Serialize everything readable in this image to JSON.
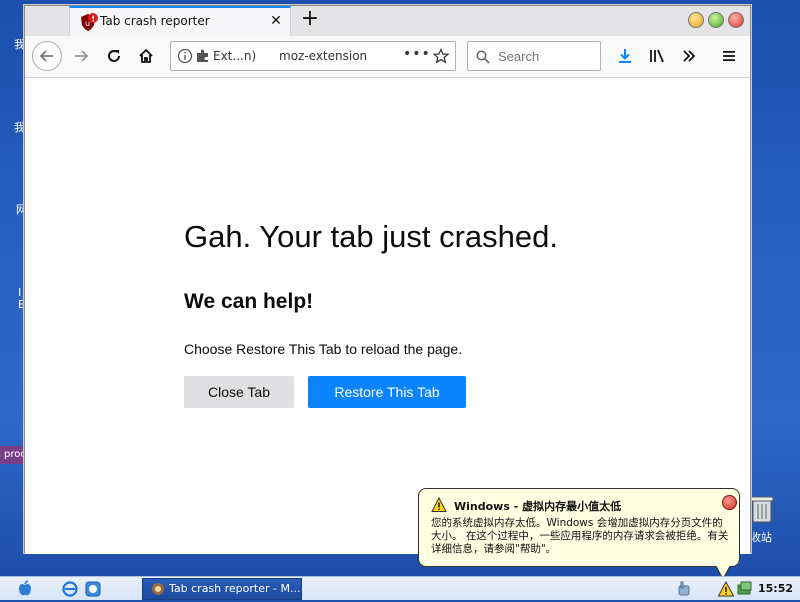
{
  "desktop": {
    "labels": [
      "我",
      "我",
      "网",
      "I",
      "E"
    ],
    "pill_label": "proc",
    "recycle_label": "收站"
  },
  "browser": {
    "tab_title": "Tab crash reporter",
    "new_tab_label": "+",
    "tab_close_label": "✕",
    "urlbar": {
      "identity_label": "Ext...n)",
      "url_text": "moz-extension",
      "page_actions_label": "•••"
    },
    "search": {
      "placeholder": "Search"
    }
  },
  "page": {
    "title": "Gah. Your tab just crashed.",
    "help_heading": "We can help!",
    "help_text": "Choose Restore This Tab to reload the page.",
    "close_tab_label": "Close Tab",
    "restore_tab_label": "Restore This Tab"
  },
  "taskbar": {
    "task_label": "Tab crash reporter - M...",
    "clock": "15:52"
  },
  "balloon": {
    "title": "Windows - 虚拟内存最小值太低",
    "text": "您的系统虚拟内存太低。Windows 会增加虚拟内存分页文件的大小。 在这个过程中，一些应用程序的内存请求会被拒绝。有关详细信息，请参阅\"帮助\"。"
  },
  "colors": {
    "accent": "#0a84ff",
    "desktop_bg": "#2a62c4",
    "balloon_bg": "#ffffe1"
  }
}
